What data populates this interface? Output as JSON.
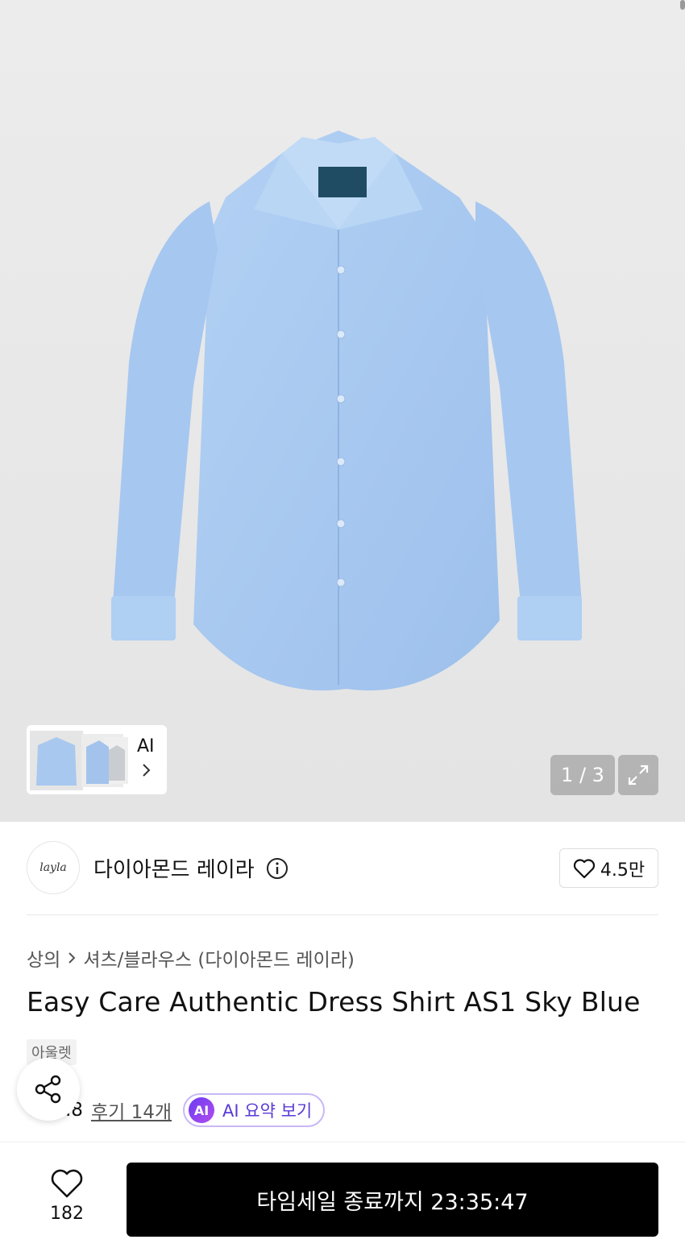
{
  "gallery": {
    "counter": "1 / 3",
    "thumb_label": "AI"
  },
  "brand": {
    "logo_text": "layla",
    "name": "다이아몬드 레이라",
    "likes": "4.5만"
  },
  "breadcrumb": {
    "category": "상의",
    "subcategory": "셔츠/블라우스 (다이아몬드 레이라)"
  },
  "product": {
    "title": "Easy Care Authentic Dress Shirt AS1 Sky Blue",
    "badge": "아울렛",
    "rating": ".8",
    "reviews": "후기 14개",
    "ai_summary": "AI 요약 보기",
    "ai_icon_text": "AI"
  },
  "bottom": {
    "wish_count": "182",
    "cta_label": "타임세일 종료까지 23:35:47"
  },
  "colors": {
    "shirt": "#a8c8ef",
    "accent_ai": "#5a3ad6",
    "cta_bg": "#000000"
  }
}
